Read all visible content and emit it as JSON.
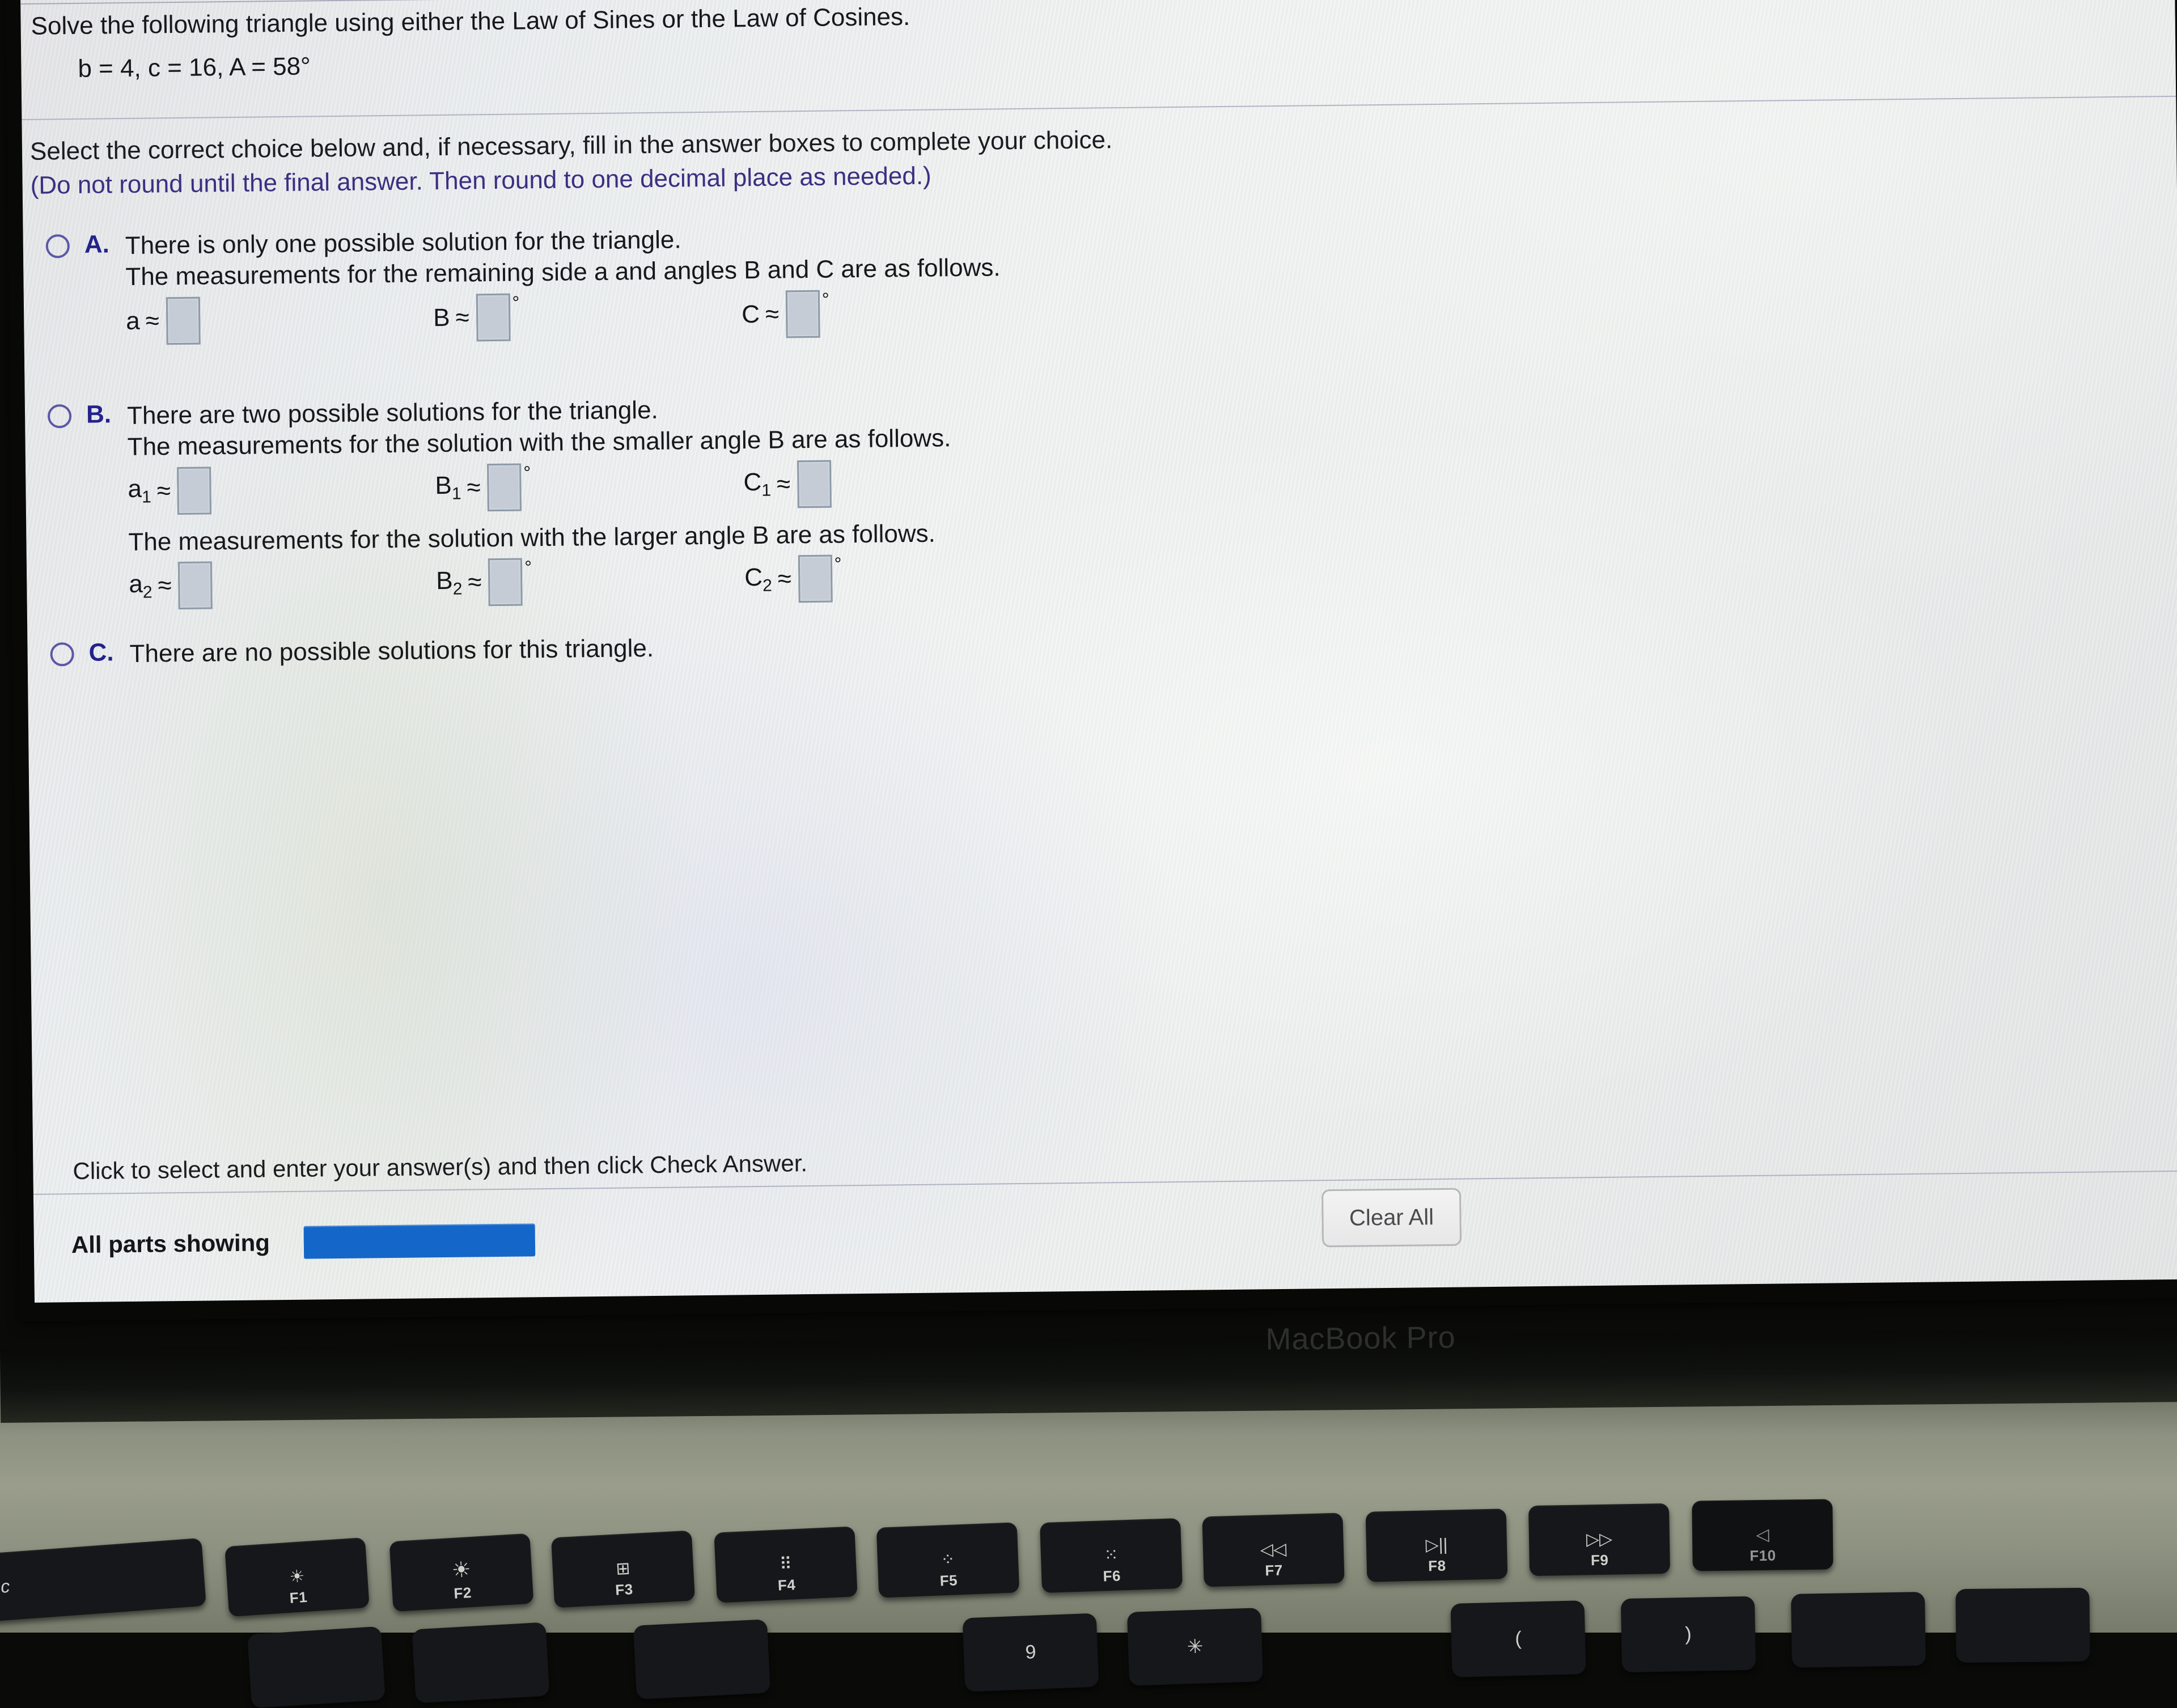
{
  "device": {
    "brand_label": "MacBook Pro"
  },
  "problem": {
    "prompt": "Solve the following triangle using either the Law of Sines or the Law of Cosines.",
    "given": "b = 4, c = 16, A = 58°",
    "instruction_line1": "Select the correct choice below and, if necessary, fill in the answer boxes to complete your choice.",
    "instruction_line2": "(Do not round until the final answer. Then round to one decimal place as needed.)"
  },
  "choices": [
    {
      "letter": "A.",
      "text": "There is only one possible solution for the triangle.",
      "subtext": "The measurements for the remaining side a and angles B and C are as follows.",
      "fields": [
        {
          "label": "a",
          "sub": "",
          "approx": "≈",
          "value": "",
          "degree": ""
        },
        {
          "label": "B",
          "sub": "",
          "approx": "≈",
          "value": "",
          "degree": "°"
        },
        {
          "label": "C",
          "sub": "",
          "approx": "≈",
          "value": "",
          "degree": "°"
        }
      ]
    },
    {
      "letter": "B.",
      "text": "There are two possible solutions for the triangle.",
      "subtext": "The measurements for the solution with the smaller angle B are as follows.",
      "fields": [
        {
          "label": "a",
          "sub": "1",
          "approx": "≈",
          "value": "",
          "degree": ""
        },
        {
          "label": "B",
          "sub": "1",
          "approx": "≈",
          "value": "",
          "degree": "°"
        },
        {
          "label": "C",
          "sub": "1",
          "approx": "≈",
          "value": "",
          "degree": ""
        }
      ],
      "subtext2": "The measurements for the solution with the larger angle B are as follows.",
      "fields2": [
        {
          "label": "a",
          "sub": "2",
          "approx": "≈",
          "value": "",
          "degree": ""
        },
        {
          "label": "B",
          "sub": "2",
          "approx": "≈",
          "value": "",
          "degree": "°"
        },
        {
          "label": "C",
          "sub": "2",
          "approx": "≈",
          "value": "",
          "degree": "°"
        }
      ]
    },
    {
      "letter": "C.",
      "text": "There are no possible solutions for this triangle.",
      "subtext": "",
      "fields": []
    }
  ],
  "footer": {
    "note": "Click to select and enter your answer(s) and then click Check Answer.",
    "clear_all_label": "Clear All",
    "parts_label": "All parts showing",
    "progress_text": "",
    "progress_color": "#1566c9"
  },
  "keyboard": {
    "esc_label": "esc",
    "function_keys": [
      {
        "fk": "F1",
        "glyph": "☀",
        "name": "brightness-down"
      },
      {
        "fk": "F2",
        "glyph": "☀",
        "name": "brightness-up"
      },
      {
        "fk": "F3",
        "glyph": "⊞",
        "name": "mission-control"
      },
      {
        "fk": "F4",
        "glyph": "⠿",
        "name": "launchpad"
      },
      {
        "fk": "F5",
        "glyph": "⁘",
        "name": "keyboard-backlight-down"
      },
      {
        "fk": "F6",
        "glyph": "⁙",
        "name": "keyboard-backlight-up"
      },
      {
        "fk": "F7",
        "glyph": "◁◁",
        "name": "rewind"
      },
      {
        "fk": "F8",
        "glyph": "▷||",
        "name": "play-pause"
      },
      {
        "fk": "F9",
        "glyph": "▷▷",
        "name": "fast-forward"
      },
      {
        "fk": "F10",
        "glyph": "◁",
        "name": "mute"
      }
    ],
    "row2_glyphs": [
      "9",
      "✳",
      "(",
      ")"
    ]
  },
  "theme": {
    "choice_letter_color": "#23228c",
    "instruction_highlight_color": "#3b2f82",
    "answer_box_fill": "#c5ccd6",
    "answer_box_border": "#8e9aa8"
  }
}
